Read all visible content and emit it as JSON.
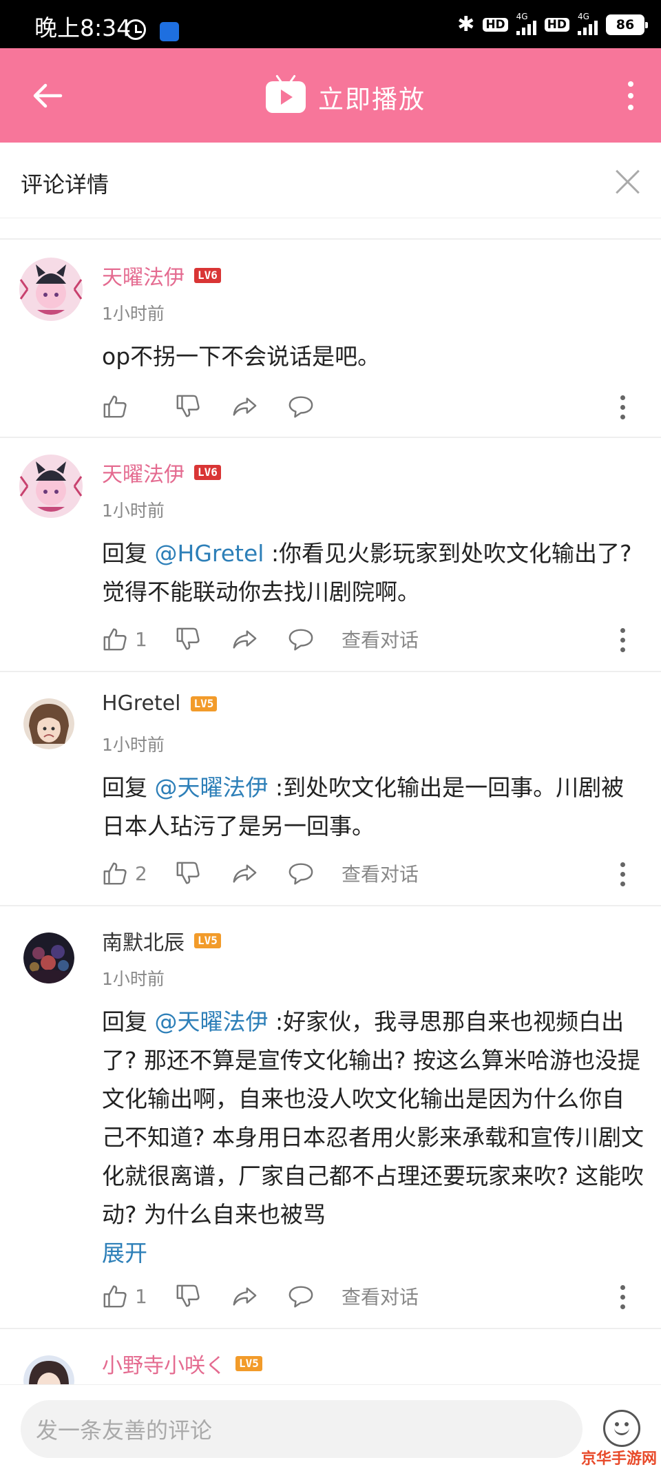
{
  "status_bar": {
    "time": "晚上8:34",
    "hd1": "HD",
    "net1": "4G",
    "hd2": "HD",
    "net2": "4G",
    "battery": "86"
  },
  "header": {
    "play_label": "立即播放"
  },
  "panel": {
    "title": "评论详情"
  },
  "comments": [
    {
      "user": "天曜法伊",
      "level": "LV6",
      "time": "1小时前",
      "text": "op不拐一下不会说话是吧。",
      "likes": "",
      "view_conversation": ""
    },
    {
      "user": "天曜法伊",
      "level": "LV6",
      "time": "1小时前",
      "reply_prefix": "回复 ",
      "mention": "@HGretel",
      "text": " :你看见火影玩家到处吹文化输出了?觉得不能联动你去找川剧院啊。",
      "likes": "1",
      "view_conversation": "查看对话"
    },
    {
      "user": "HGretel",
      "level": "LV5",
      "time": "1小时前",
      "reply_prefix": "回复 ",
      "mention": "@天曜法伊",
      "text": " :到处吹文化输出是一回事。川剧被日本人玷污了是另一回事。",
      "likes": "2",
      "view_conversation": "查看对话"
    },
    {
      "user": "南默北辰",
      "level": "LV5",
      "time": "1小时前",
      "reply_prefix": "回复 ",
      "mention": "@天曜法伊",
      "text": " :好家伙，我寻思那自来也视频白出了? 那还不算是宣传文化输出? 按这么算米哈游也没提文化输出啊，自来也没人吹文化输出是因为什么你自己不知道? 本身用日本忍者用火影来承载和宣传川剧文化就很离谱，厂家自己都不占理还要玩家来吹? 这能吹动? 为什么自来也被骂",
      "expand": "展开",
      "likes": "1",
      "view_conversation": "查看对话"
    },
    {
      "user": "小野寺小咲く",
      "level": "LV5"
    }
  ],
  "input": {
    "placeholder": "发一条友善的评论"
  },
  "watermark": "京华手游网"
}
